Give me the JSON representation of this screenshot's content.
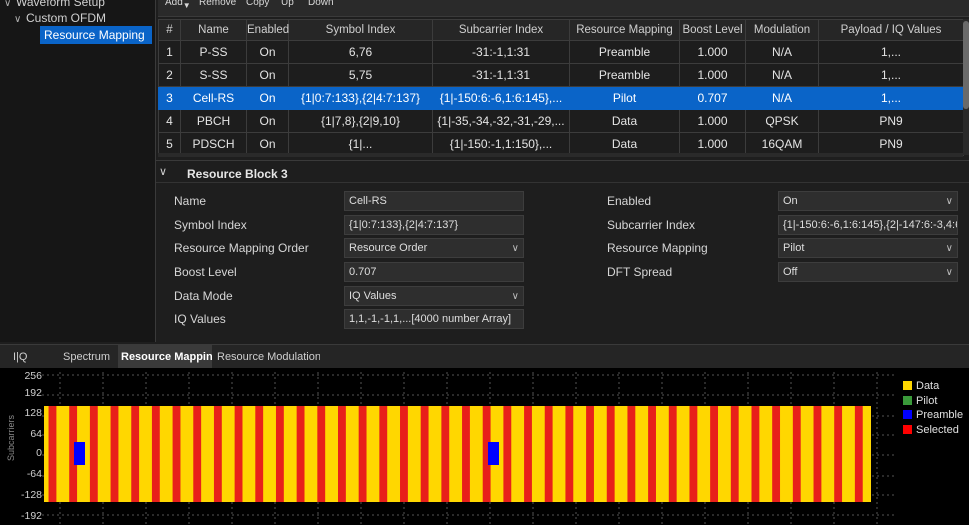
{
  "tree": {
    "root_label": "Waveform Setup",
    "child_label": "Custom OFDM",
    "selected_label": "Resource Mapping"
  },
  "toolbar": {
    "add": "Add",
    "remove": "Remove",
    "copy": "Copy",
    "up": "Up",
    "down": "Down"
  },
  "table": {
    "headers": [
      "#",
      "Name",
      "Enabled",
      "Symbol Index",
      "Subcarrier Index",
      "Resource Mapping",
      "Boost Level",
      "Modulation",
      "Payload / IQ Values"
    ],
    "rows": [
      [
        "1",
        "P-SS",
        "On",
        "6,76",
        "-31:-1,1:31",
        "Preamble",
        "1.000",
        "N/A",
        "1,..."
      ],
      [
        "2",
        "S-SS",
        "On",
        "5,75",
        "-31:-1,1:31",
        "Preamble",
        "1.000",
        "N/A",
        "1,..."
      ],
      [
        "3",
        "Cell-RS",
        "On",
        "{1|0:7:133},{2|4:7:137}",
        "{1|-150:6:-6,1:6:145},...",
        "Pilot",
        "0.707",
        "N/A",
        "1,..."
      ],
      [
        "4",
        "PBCH",
        "On",
        "{1|7,8},{2|9,10}",
        "{1|-35,-34,-32,-31,-29,...",
        "Data",
        "1.000",
        "QPSK",
        "PN9"
      ],
      [
        "5",
        "PDSCH",
        "On",
        "{1|...",
        "{1|-150:-1,1:150},...",
        "Data",
        "1.000",
        "16QAM",
        "PN9"
      ]
    ],
    "selected_row": 2
  },
  "details": {
    "title": "Resource Block 3",
    "name_label": "Name",
    "name_value": "Cell-RS",
    "symbol_label": "Symbol Index",
    "symbol_value": "{1|0:7:133},{2|4:7:137}",
    "order_label": "Resource Mapping Order",
    "order_value": "Resource Order",
    "boost_label": "Boost Level",
    "boost_value": "0.707",
    "datamode_label": "Data Mode",
    "datamode_value": "IQ Values",
    "iq_label": "IQ Values",
    "iq_value": "1,1,-1,-1,1,...[4000 number Array]",
    "enabled_label": "Enabled",
    "enabled_value": "On",
    "subcarrier_label": "Subcarrier Index",
    "subcarrier_value": "{1|-150:6:-6,1:6:145},{2|-147:6:-3,4:6:",
    "mapping_label": "Resource Mapping",
    "mapping_value": "Pilot",
    "dft_label": "DFT Spread",
    "dft_value": "Off"
  },
  "bottom_tabs": [
    "I|Q",
    "Spectrum",
    "Resource Mapping",
    "Resource Modulation"
  ],
  "active_tab": 2,
  "plot": {
    "ylabel": "Subcarriers",
    "yticks": [
      "256",
      "192",
      "128",
      "64",
      "0",
      "-64",
      "-128",
      "-192"
    ],
    "legend": [
      {
        "label": "Data",
        "color": "#ffd700"
      },
      {
        "label": "Pilot",
        "color": "#3a9a3a"
      },
      {
        "label": "Preamble",
        "color": "#0000ff"
      },
      {
        "label": "Selected",
        "color": "#ff0000"
      }
    ],
    "colors": {
      "data": "#ffd700",
      "selected": "#e8201a",
      "preamble": "#0000ff",
      "grid": "#555555"
    }
  }
}
